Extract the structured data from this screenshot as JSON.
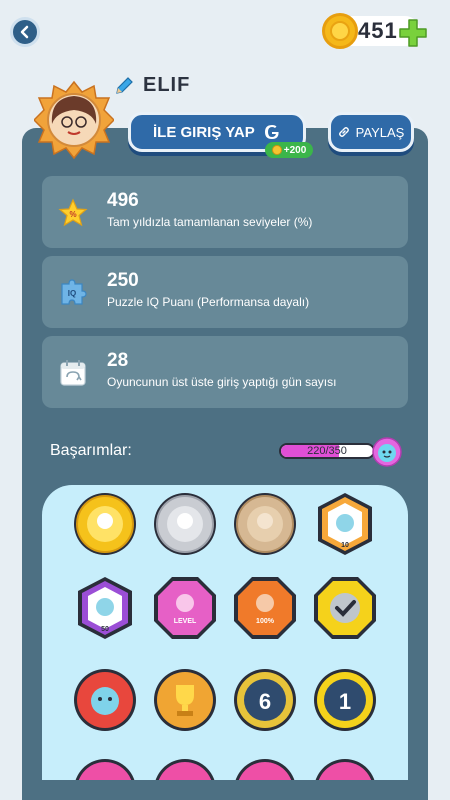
{
  "header": {
    "coins": "451",
    "icons": {
      "back": "back-arrow-icon",
      "coin": "coin-icon",
      "plus": "plus-icon"
    }
  },
  "profile": {
    "name": "ELIF",
    "login_button": "İLE GIRIŞ YAP",
    "login_reward": "+200",
    "share_button": "PAYLAŞ"
  },
  "stats": [
    {
      "value": "496",
      "label": "Tam yıldızla tamamlanan seviyeler (%)",
      "icon": "star-percent-icon"
    },
    {
      "value": "250",
      "label": "Puzzle IQ Puanı (Performansa dayalı)",
      "icon": "iq-puzzle-icon"
    },
    {
      "value": "28",
      "label": "Oyuncunun üst üste giriş yaptığı gün sayısı",
      "icon": "calendar-icon"
    }
  ],
  "achievements": {
    "title": "Başarımlar:",
    "progress_text": "220/350",
    "progress_value": 220,
    "progress_max": 350,
    "badges": [
      {
        "name": "gold-medal-badge",
        "label": ""
      },
      {
        "name": "silver-medal-badge",
        "label": ""
      },
      {
        "name": "bronze-medal-badge",
        "label": ""
      },
      {
        "name": "top-10-badge",
        "label": "10"
      },
      {
        "name": "top-50-badge",
        "label": "50"
      },
      {
        "name": "level-badge",
        "label": "LEVEL"
      },
      {
        "name": "percent-100-badge",
        "label": "100%"
      },
      {
        "name": "checkmark-badge",
        "label": ""
      },
      {
        "name": "red-character-badge",
        "label": ""
      },
      {
        "name": "trophy-badge",
        "label": ""
      },
      {
        "name": "six-months-badge",
        "label": "6"
      },
      {
        "name": "one-year-badge",
        "label": "1"
      }
    ]
  }
}
